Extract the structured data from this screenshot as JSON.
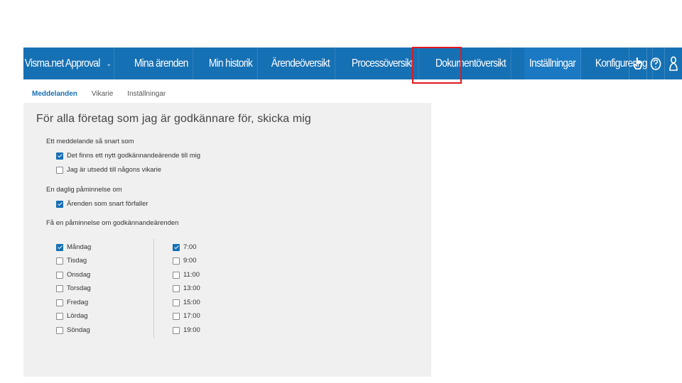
{
  "nav": {
    "brand": "Visma.net Approval",
    "brand_chevron": "⌄",
    "items": [
      {
        "label": "Mina ärenden"
      },
      {
        "label": "Min historik"
      },
      {
        "label": "Ärendeöversikt"
      },
      {
        "label": "Processöversikt"
      },
      {
        "label": "Dokumentöversikt"
      },
      {
        "label": "Inställningar",
        "active": true
      },
      {
        "label": "Konfigurering"
      }
    ],
    "icons": [
      "hand-pointer-icon",
      "help-icon",
      "user-icon"
    ]
  },
  "subtabs": [
    {
      "label": "Meddelanden",
      "active": true
    },
    {
      "label": "Vikarie"
    },
    {
      "label": "Inställningar"
    }
  ],
  "panel": {
    "title": "För alla företag som jag är godkännare för, skicka mig",
    "section1": {
      "label": "Ett meddelande så snart som",
      "options": [
        {
          "label": "Det finns ett nytt godkännandeärende till mig",
          "checked": true
        },
        {
          "label": "Jag är utsedd till någons vikarie",
          "checked": false
        }
      ]
    },
    "section2": {
      "label": "En daglig påminnelse om",
      "options": [
        {
          "label": "Ärenden som snart förfaller",
          "checked": true
        }
      ]
    },
    "section3": {
      "label": "Få en påminnelse om godkännandeärenden",
      "days": [
        {
          "label": "Måndag",
          "checked": true
        },
        {
          "label": "Tisdag",
          "checked": false
        },
        {
          "label": "Onsdag",
          "checked": false
        },
        {
          "label": "Torsdag",
          "checked": false
        },
        {
          "label": "Fredag",
          "checked": false
        },
        {
          "label": "Lördag",
          "checked": false
        },
        {
          "label": "Söndag",
          "checked": false
        }
      ],
      "times": [
        {
          "label": "7:00",
          "checked": true
        },
        {
          "label": "9:00",
          "checked": false
        },
        {
          "label": "11:00",
          "checked": false
        },
        {
          "label": "13:00",
          "checked": false
        },
        {
          "label": "15:00",
          "checked": false
        },
        {
          "label": "17:00",
          "checked": false
        },
        {
          "label": "19:00",
          "checked": false
        }
      ]
    }
  },
  "colors": {
    "nav_bg": "#1670b4",
    "highlight": "#e0171f",
    "panel_bg": "#f0f0f0"
  }
}
